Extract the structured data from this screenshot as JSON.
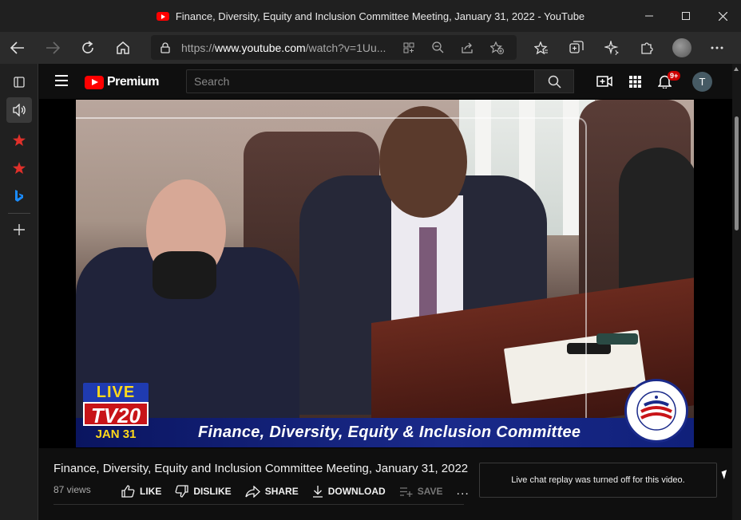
{
  "window": {
    "title": "Finance, Diversity, Equity and Inclusion Committee Meeting, January 31, 2022 - YouTube"
  },
  "browser": {
    "url_prefix": "https://",
    "url_domain": "www.youtube.com",
    "url_path": "/watch?v=1Uu..."
  },
  "youtube": {
    "logo_text": "Premium",
    "search_placeholder": "Search",
    "notification_count": "9+",
    "avatar_initial": "T"
  },
  "video": {
    "overlay": {
      "live": "LIVE",
      "channel": "TV20",
      "date": "JAN 31",
      "banner": "Finance, Diversity, Equity & Inclusion Committee"
    },
    "title": "Finance, Diversity, Equity and Inclusion Committee Meeting, January 31, 2022",
    "views": "87 views"
  },
  "actions": {
    "like": "LIKE",
    "dislike": "DISLIKE",
    "share": "SHARE",
    "download": "DOWNLOAD",
    "save": "SAVE",
    "more": "..."
  },
  "chat": {
    "message": "Live chat replay was turned off for this video."
  }
}
